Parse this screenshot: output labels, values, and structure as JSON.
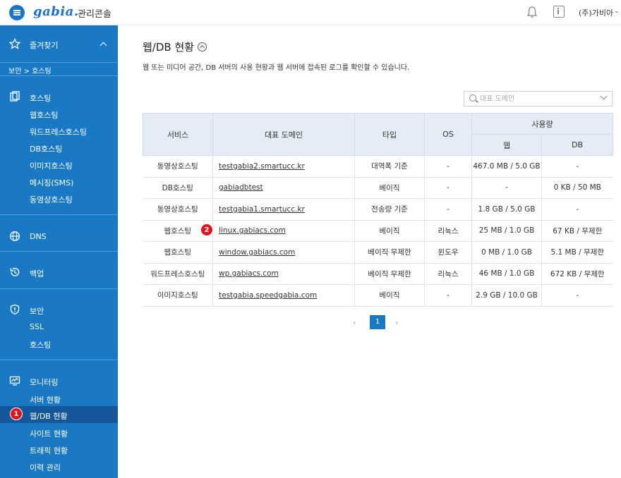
{
  "app": {
    "logo": "gabia.",
    "title": "관리콘솔"
  },
  "header": {
    "user": "(주)가비아",
    "icons": [
      "bell-icon",
      "info-icon",
      "chevron-down-icon"
    ]
  },
  "sidebar": {
    "favorites": "즐겨찾기",
    "breadcrumb": "보안 > 호스팅",
    "hosting": {
      "label": "호스팅",
      "items": [
        "웹호스팅",
        "워드프레스호스팅",
        "DB호스팅",
        "이미지호스팅",
        "메시징(SMS)",
        "동영상호스팅"
      ]
    },
    "dns": "DNS",
    "backup": "백업",
    "security": {
      "label": "보안",
      "items": [
        "SSL",
        "호스팅"
      ]
    },
    "monitoring": {
      "label": "모니터링",
      "items": [
        "서버 현황",
        "웹/DB 현황",
        "사이트 현황",
        "트래픽 현황",
        "이력 관리"
      ]
    },
    "accent": "#1a79c4",
    "active_color": "#14589a"
  },
  "badges": {
    "first": "1",
    "second": "2",
    "color": "#e0131e"
  },
  "main": {
    "title": "웹/DB 현황",
    "description": "웹 또는 미디어 공간, DB 서버의 사용 현황과 웹 서버에 접속된 로그를 확인할 수 있습니다.",
    "search_placeholder": "대표 도메인"
  },
  "table": {
    "headers": {
      "service": "서비스",
      "domain": "대표 도메인",
      "type": "타입",
      "os": "OS",
      "usage": "사용량",
      "web": "웹",
      "db": "DB"
    },
    "rows": [
      {
        "service": "동영상호스팅",
        "domain": "testgabia2.smartucc.kr",
        "type": "대역폭 기준",
        "os": "-",
        "web": "467.0 MB / 5.0 GB",
        "db": "-"
      },
      {
        "service": "DB호스팅",
        "domain": "gabiadbtest",
        "type": "베이직",
        "os": "-",
        "web": "-",
        "db": "0 KB / 50 MB"
      },
      {
        "service": "동영상호스팅",
        "domain": "testgabia1.smartucc.kr",
        "type": "전송량 기준",
        "os": "-",
        "web": "1.8 GB / 5.0 GB",
        "db": "-"
      },
      {
        "service": "웹호스팅",
        "domain": "linux.gabiacs.com",
        "type": "베이직",
        "os": "리눅스",
        "web": "25 MB / 1.0 GB",
        "db": "67 KB / 무제한"
      },
      {
        "service": "웹호스팅",
        "domain": "window.gabiacs.com",
        "type": "베이직 무제한",
        "os": "윈도우",
        "web": "0 MB / 1.0 GB",
        "db": "5.1 MB / 무제한"
      },
      {
        "service": "워드프레스호스팅",
        "domain": "wp.gabiacs.com",
        "type": "베이직 무제한",
        "os": "리눅스",
        "web": "46 MB / 1.0 GB",
        "db": "672 KB / 무제한"
      },
      {
        "service": "이미지호스팅",
        "domain": "testgabia.speedgabia.com",
        "type": "베이직",
        "os": "-",
        "web": "2.9 GB / 10.0 GB",
        "db": "-"
      }
    ]
  },
  "pagination": {
    "prev": "‹",
    "current": "1",
    "next": "›"
  }
}
